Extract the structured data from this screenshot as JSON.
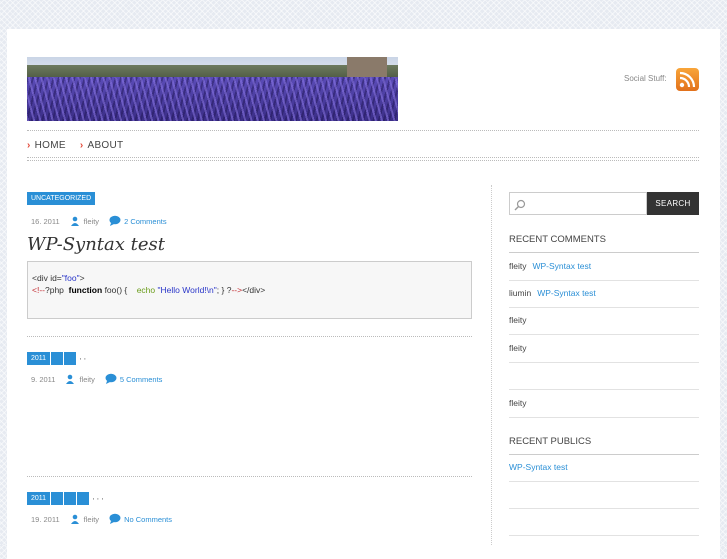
{
  "header": {
    "social_label": "Social Stuff:",
    "rss_icon": "rss-feed-icon"
  },
  "nav": {
    "items": [
      {
        "label": "HOME"
      },
      {
        "label": "ABOUT"
      }
    ]
  },
  "posts": [
    {
      "tags": [
        "UNCATEGORIZED"
      ],
      "tag_suffix": "",
      "date": "16. 2011",
      "author": "fleity",
      "comments": "2 Comments",
      "title": "WP-Syntax test",
      "code": {
        "line1_open": "<div id=",
        "line1_str": "\"foo\"",
        "line1_close": ">",
        "line2_comment": "<!--",
        "line2_php": "?php",
        "line2_kw": "function",
        "line2_fn": "foo() {",
        "line2_echo": "echo",
        "line2_str": "\"Hello World!\\n\"",
        "line2_rest": ";  } ?",
        "line2_comment_end": "-->",
        "line2_tail": "</div>"
      }
    },
    {
      "tags": [
        "2011"
      ],
      "tag_suffix": ", ,",
      "date": "9. 2011",
      "author": "fleity",
      "comments": "5 Comments"
    },
    {
      "tags": [
        "2011"
      ],
      "tag_suffix": ", , ,",
      "date": "19. 2011",
      "author": "fleity",
      "comments": "No Comments"
    }
  ],
  "sidebar": {
    "search": {
      "placeholder": "",
      "button": "SEARCH"
    },
    "recent_comments": {
      "heading": "RECENT COMMENTS",
      "items": [
        {
          "author": "fleity",
          "link": "WP-Syntax test"
        },
        {
          "author": "liumin",
          "link": "WP-Syntax test"
        },
        {
          "author": "fleity",
          "link": ""
        },
        {
          "author": "fleity",
          "link": ""
        },
        {
          "author": "",
          "link": ""
        },
        {
          "author": "fleity",
          "link": ""
        }
      ]
    },
    "recent_publics": {
      "heading": "RECENT PUBLICS",
      "items": [
        {
          "link": "WP-Syntax test"
        }
      ]
    }
  },
  "colors": {
    "accent": "#2a8fd6",
    "nav_bullet": "#e34b3b",
    "rss": "#f08a24"
  }
}
